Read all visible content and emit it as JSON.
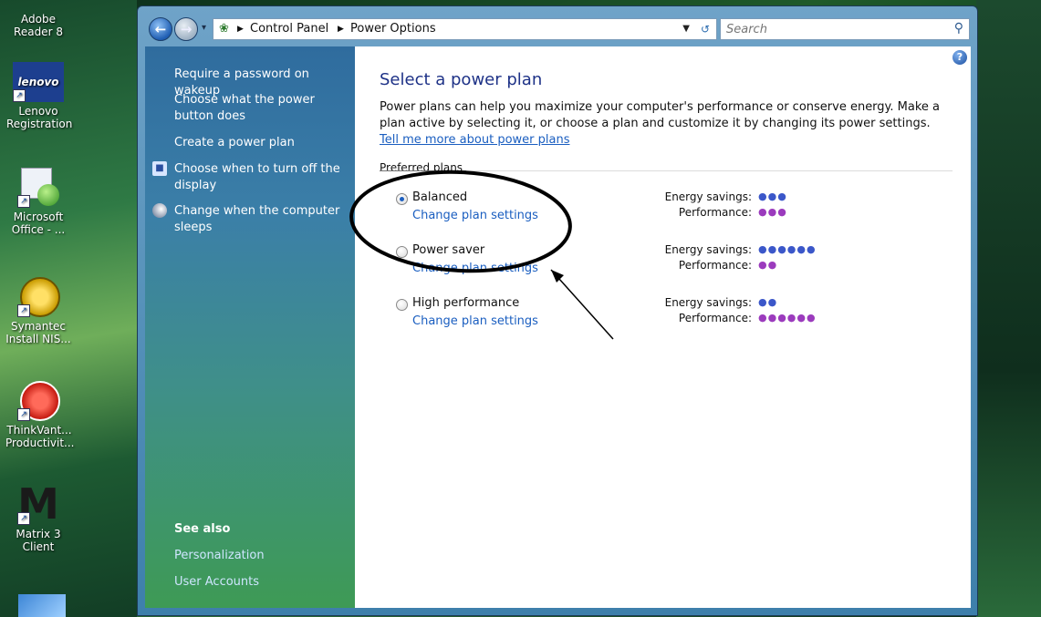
{
  "desktop": {
    "icons": [
      {
        "label": "Adobe Reader 8"
      },
      {
        "label": "Lenovo Registration",
        "logo": "lenovo"
      },
      {
        "label": "Microsoft Office - ..."
      },
      {
        "label": "Symantec Install NIS..."
      },
      {
        "label": "ThinkVant... Productivit..."
      },
      {
        "label": "Matrix 3 Client",
        "logo": "M"
      }
    ]
  },
  "window": {
    "breadcrumb": [
      "Control Panel",
      "Power Options"
    ],
    "search_placeholder": "Search"
  },
  "left_pane": {
    "tasks": [
      {
        "label": "Require a password on wakeup"
      },
      {
        "label": "Choose what the power button does"
      },
      {
        "label": "Create a power plan"
      },
      {
        "label": "Choose when to turn off the display"
      },
      {
        "label": "Change when the computer sleeps"
      }
    ],
    "see_also_title": "See also",
    "see_also": [
      {
        "label": "Personalization"
      },
      {
        "label": "User Accounts"
      }
    ]
  },
  "main": {
    "title": "Select a power plan",
    "description": "Power plans can help you maximize your computer's performance or conserve energy. Make a plan active by selecting it, or choose a plan and customize it by changing its power settings.",
    "description_link": "Tell me more about power plans",
    "section_header": "Preferred plans",
    "energy_label": "Energy savings:",
    "performance_label": "Performance:",
    "plans": [
      {
        "name": "Balanced",
        "link": "Change plan settings",
        "selected": true,
        "energy_dots": 3,
        "performance_dots": 3
      },
      {
        "name": "Power saver",
        "link": "Change plan settings",
        "selected": false,
        "energy_dots": 6,
        "performance_dots": 2
      },
      {
        "name": "High performance",
        "link": "Change plan settings",
        "selected": false,
        "energy_dots": 2,
        "performance_dots": 6
      }
    ]
  },
  "colors": {
    "link": "#1a5ec0",
    "title": "#1e3287",
    "energy_dot": "#3b57c9",
    "performance_dot": "#9b3bbd"
  }
}
